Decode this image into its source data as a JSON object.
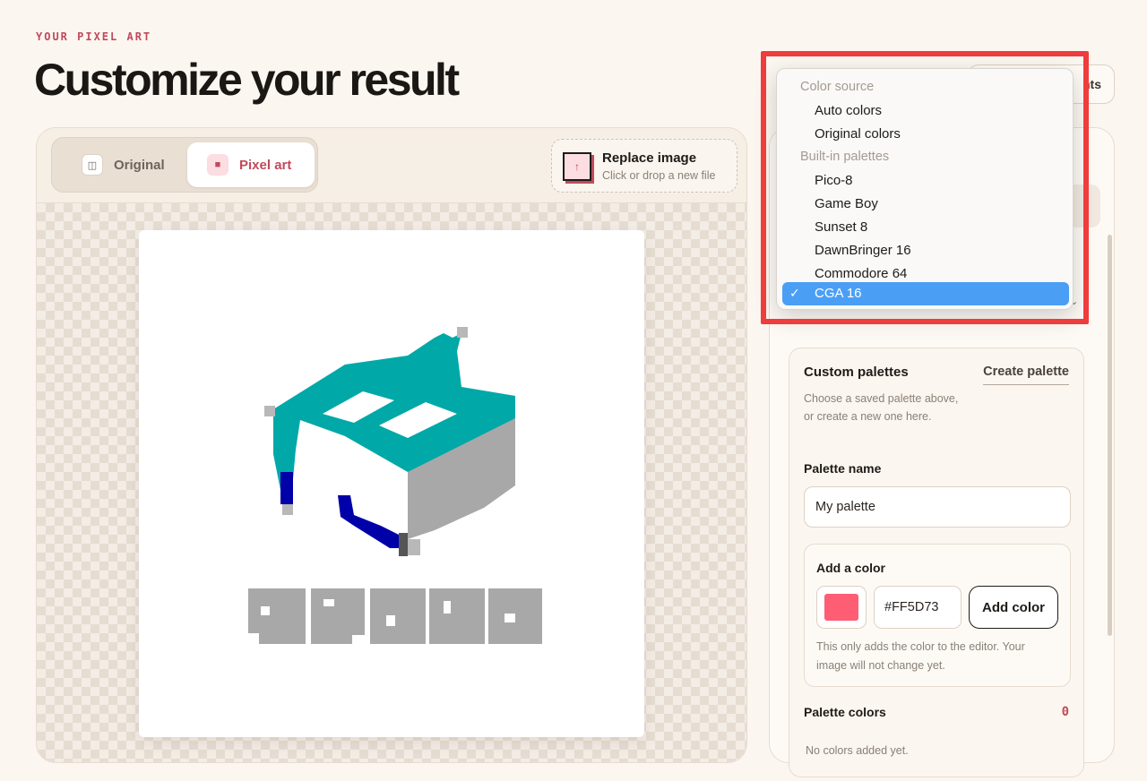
{
  "header": {
    "eyebrow": "YOUR PIXEL ART",
    "title": "Customize your result"
  },
  "preview": {
    "tabs": [
      {
        "label": "Original",
        "icon": "split-view-icon"
      },
      {
        "label": "Pixel art",
        "icon": "pixel-grid-icon"
      }
    ],
    "replace": {
      "title": "Replace image",
      "subtitle": "Click or drop a new file",
      "icon": "upload-arrow-icon"
    }
  },
  "toolbar": {
    "presets_label_partial": "nts"
  },
  "dropdown": {
    "groups": [
      {
        "label": "Color source",
        "items": [
          "Auto colors",
          "Original colors"
        ]
      },
      {
        "label": "Built-in palettes",
        "items": [
          "Pico-8",
          "Game Boy",
          "Sunset 8",
          "DawnBringer 16",
          "Commodore 64",
          "CGA 16"
        ]
      }
    ],
    "selected": "CGA 16",
    "check_glyph": "✓"
  },
  "custom": {
    "title": "Custom palettes",
    "create_label": "Create palette",
    "description": "Choose a saved palette above, or create a new one here.",
    "name_label": "Palette name",
    "name_value": "My palette",
    "add": {
      "title": "Add a color",
      "hex_value": "#FF5D73",
      "button": "Add color",
      "note": "This only adds the color to the editor. Your image will not change yet."
    },
    "colors_label": "Palette colors",
    "colors_count": "0",
    "empty_text": "No colors added yet."
  },
  "colors": {
    "accent": "#c04a5c",
    "swatch": "#FF5D73",
    "selection": "#4a9ff5",
    "highlight": "#ef3c3c",
    "teal": "#00a8a8",
    "gray": "#a8a8a8",
    "navy": "#0000a8"
  }
}
